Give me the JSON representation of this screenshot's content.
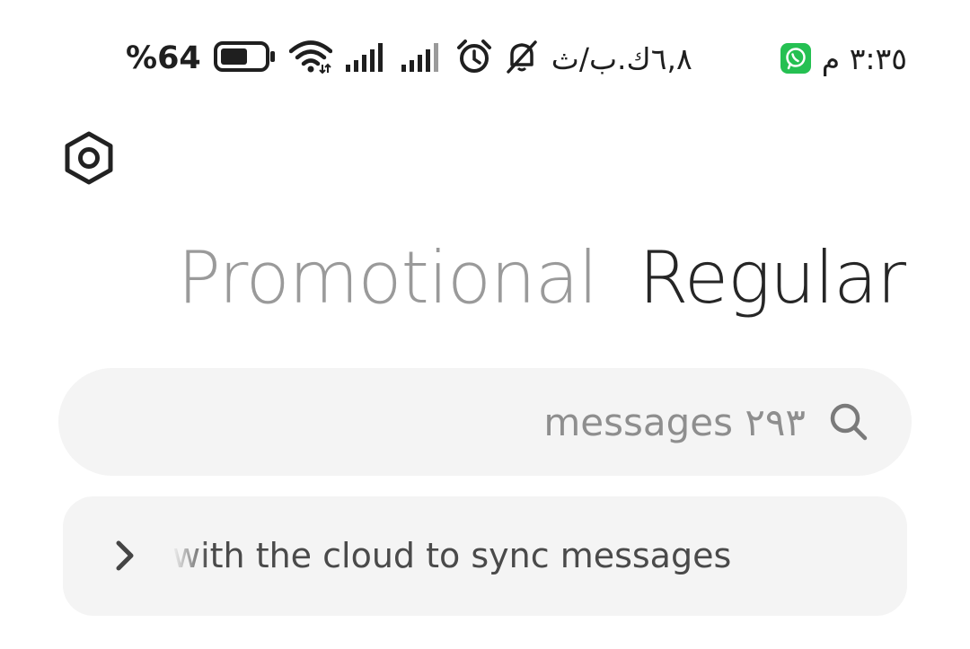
{
  "status_bar": {
    "battery_percent": "%64",
    "battery_level": 0.64,
    "network_speed": "٦,٨ك.ب/ث",
    "time": "٣:٣٥ م",
    "icons": [
      "battery-icon",
      "wifi-icon",
      "signal-icon",
      "signal-icon",
      "alarm-icon",
      "bell-off-icon",
      "whatsapp-icon"
    ]
  },
  "header": {
    "settings_icon": "settings-icon"
  },
  "tabs": [
    {
      "label": "Promotional",
      "active": false
    },
    {
      "label": "Regular",
      "active": true
    }
  ],
  "search": {
    "placeholder": "messages ٢٩٣"
  },
  "sync_banner": {
    "text": "with the cloud to sync messages"
  },
  "colors": {
    "background": "#ffffff",
    "card": "#f4f4f4",
    "inactive_tab": "#9a9a9a",
    "active_tab": "#262626",
    "whatsapp": "#25c052"
  }
}
